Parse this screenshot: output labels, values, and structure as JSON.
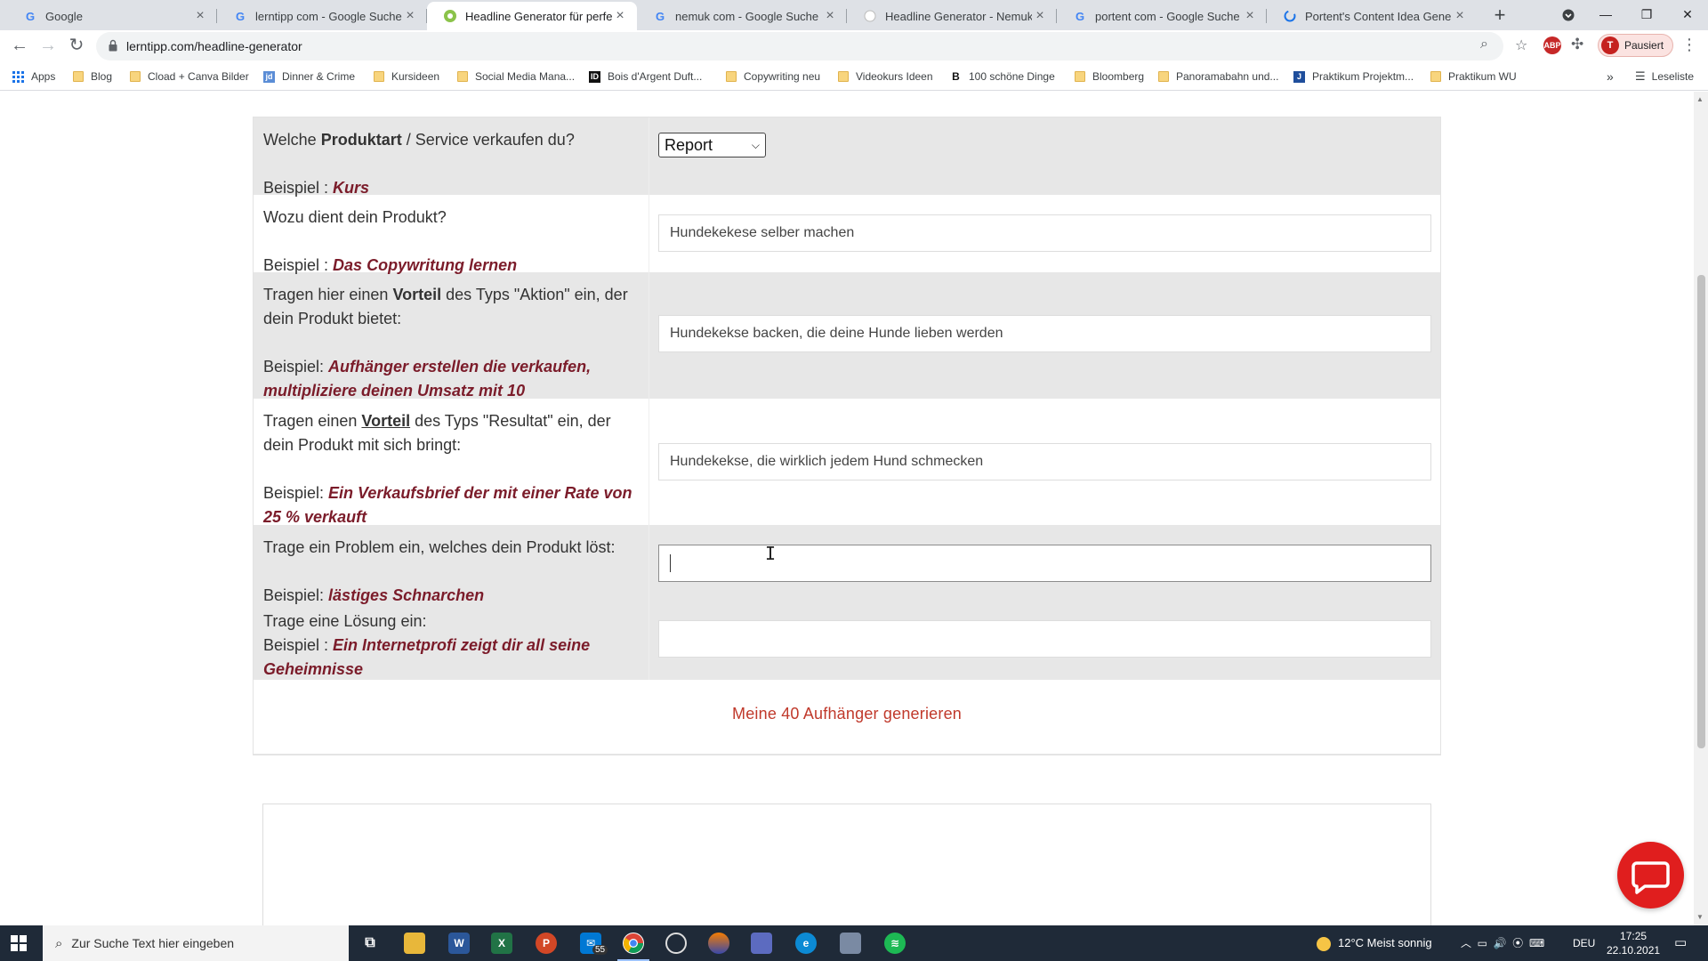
{
  "browser": {
    "tabs": [
      {
        "title": "Google",
        "icon": "google-icon"
      },
      {
        "title": "lerntipp com - Google Suche",
        "icon": "google-icon"
      },
      {
        "title": "Headline Generator für perfekte",
        "icon": "site-icon",
        "active": true
      },
      {
        "title": "nemuk com - Google Suche",
        "icon": "google-icon"
      },
      {
        "title": "Headline Generator - Nemuk",
        "icon": "site-icon"
      },
      {
        "title": "portent com - Google Suche",
        "icon": "google-icon"
      },
      {
        "title": "Portent's Content Idea Generato",
        "icon": "portent-icon"
      }
    ],
    "address": "lerntipp.com/headline-generator",
    "profile_initial": "T",
    "profile_label": "Pausiert",
    "ext_badge": "ABP",
    "bookmarks": [
      {
        "label": "Apps",
        "kind": "apps"
      },
      {
        "label": "Blog",
        "kind": "folder"
      },
      {
        "label": "Cload + Canva Bilder",
        "kind": "folder"
      },
      {
        "label": "Dinner & Crime",
        "kind": "site"
      },
      {
        "label": "Kursideen",
        "kind": "folder"
      },
      {
        "label": "Social Media Mana...",
        "kind": "folder"
      },
      {
        "label": "Bois d'Argent Duft...",
        "kind": "site"
      },
      {
        "label": "Copywriting neu",
        "kind": "folder"
      },
      {
        "label": "Videokurs Ideen",
        "kind": "folder"
      },
      {
        "label": "100 schöne Dinge",
        "kind": "site"
      },
      {
        "label": "Bloomberg",
        "kind": "folder"
      },
      {
        "label": "Panoramabahn und...",
        "kind": "folder"
      },
      {
        "label": "Praktikum Projektm...",
        "kind": "site"
      },
      {
        "label": "Praktikum WU",
        "kind": "folder"
      }
    ],
    "reading_list": "Leseliste",
    "more_bookmarks": "»"
  },
  "form": {
    "rows": [
      {
        "label_pre": "Welche ",
        "label_bold": "Produktart",
        "label_post": " / Service verkaufen du?",
        "example_prefix": "Beispiel : ",
        "example": "Kurs",
        "control": "select",
        "value": "Report"
      },
      {
        "label_pre": "Wozu dient dein Produkt?",
        "example_prefix": "Beispiel : ",
        "example": "Das Copywritung lernen",
        "control": "input",
        "value": "Hundekekese selber machen"
      },
      {
        "label_pre": "Tragen hier einen ",
        "label_bold": "Vorteil",
        "label_post": " des Typs \"Aktion\" ein, der dein Produkt bietet:",
        "example_prefix": "Beispiel: ",
        "example": "Aufhänger erstellen die verkaufen, multipliziere deinen Umsatz mit 10",
        "control": "input",
        "value": "Hundekekse backen, die deine Hunde lieben werden"
      },
      {
        "label_pre": "Tragen einen ",
        "label_bold": "Vorteil",
        "label_post": " des Typs \"Resultat\" ein, der dein Produkt mit sich bringt:",
        "example_prefix": "Beispiel: ",
        "example": "Ein Verkaufsbrief der mit einer Rate von 25 % verkauft",
        "control": "input",
        "value": "Hundekekse, die wirklich jedem Hund schmecken"
      },
      {
        "label_pre": "Trage ein Problem ein, welches dein Produkt löst:",
        "example_prefix": "Beispiel: ",
        "example": "lästiges Schnarchen",
        "control": "input",
        "value": ""
      },
      {
        "label_pre": "Trage eine Lösung ein:",
        "example_prefix": "Beispiel : ",
        "example": "Ein Internetprofi zeigt dir all seine Geheimnisse",
        "control": "input",
        "value": ""
      }
    ],
    "generate_label": "Meine 40 Aufhänger generieren"
  },
  "taskbar": {
    "search_placeholder": "Zur Suche Text hier eingeben",
    "mail_badge": "55",
    "weather": "12°C  Meist sonnig",
    "lang": "DEU",
    "time": "17:25",
    "date": "22.10.2021"
  },
  "colors": {
    "example_text": "#7b1c2a",
    "generate_link": "#c0392b",
    "shaded_row": "#e7e7e7",
    "chat_button": "#e01e1e"
  }
}
